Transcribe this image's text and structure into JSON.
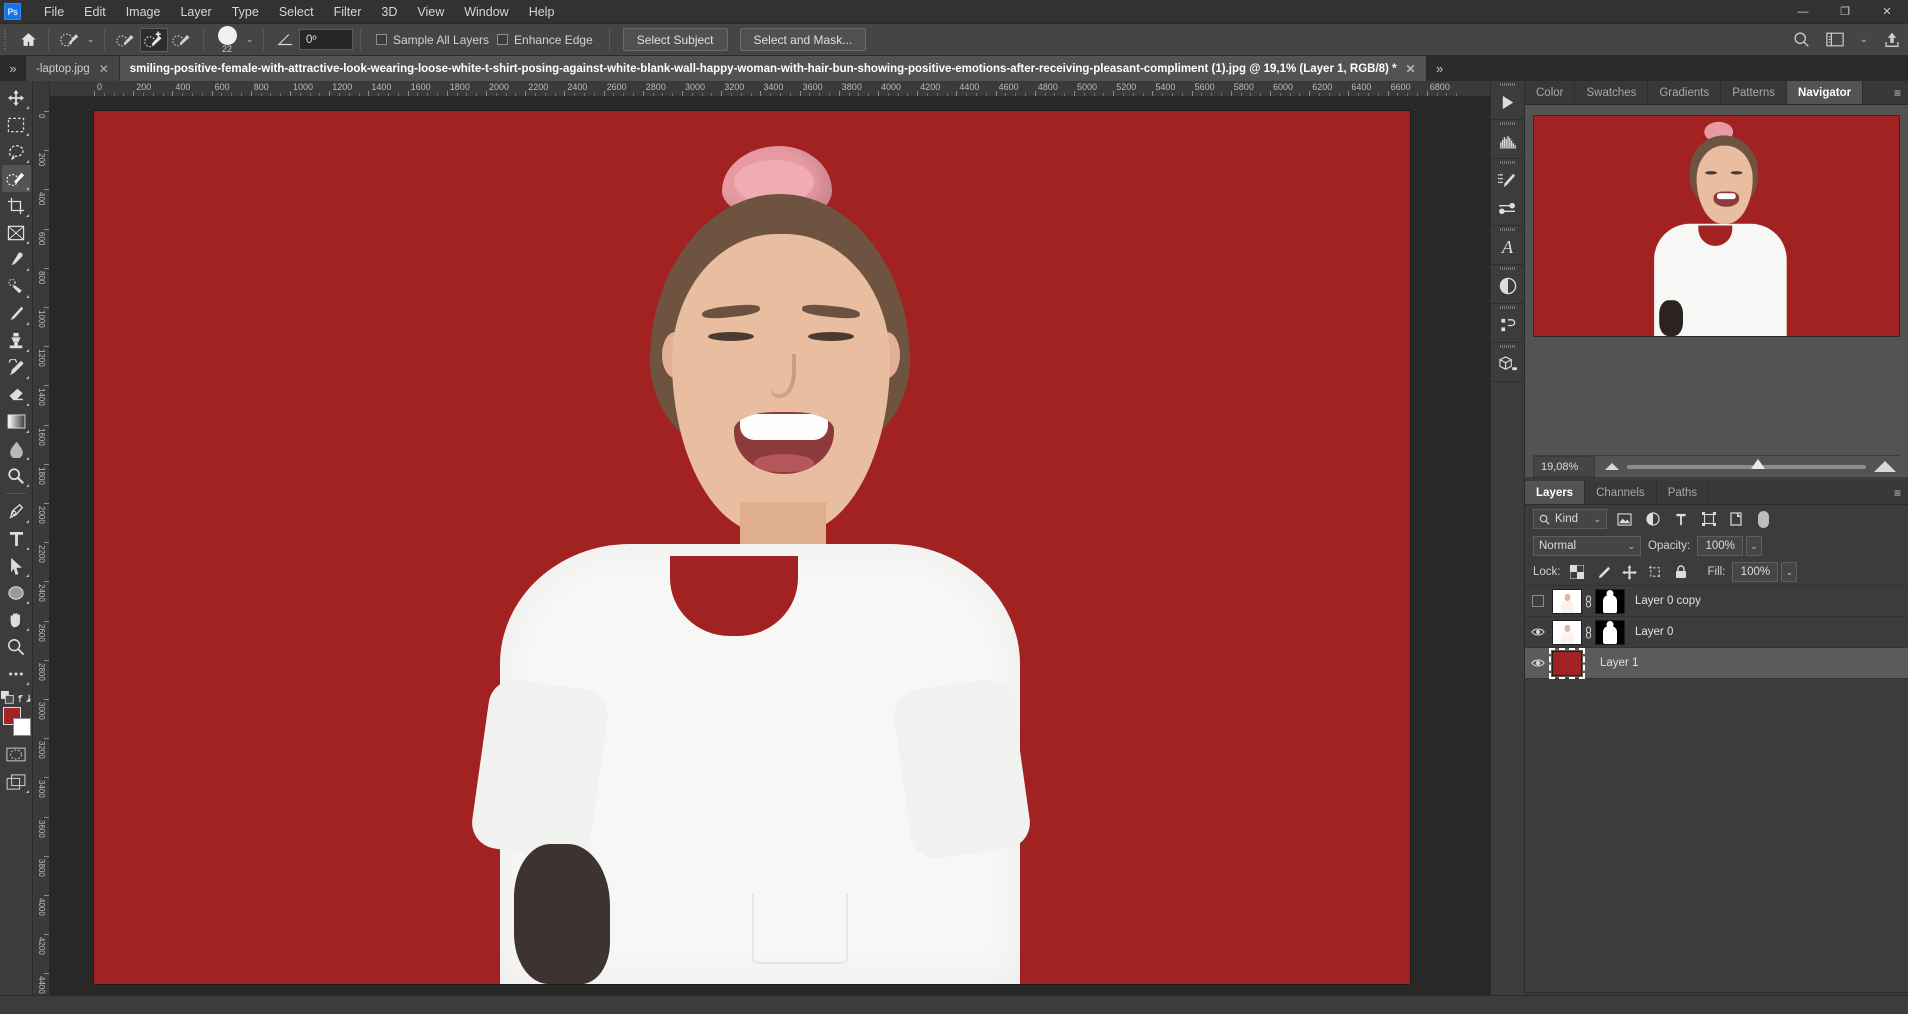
{
  "app": {
    "logo": "Ps"
  },
  "menubar": {
    "items": [
      "File",
      "Edit",
      "Image",
      "Layer",
      "Type",
      "Select",
      "Filter",
      "3D",
      "View",
      "Window",
      "Help"
    ]
  },
  "window_controls": {
    "minimize": "—",
    "maximize": "❐",
    "close": "✕"
  },
  "options_bar": {
    "home_icon": "home-icon",
    "tool_preset_icon": "quick-selection-tool-icon",
    "mode_add_icon": "selection-add-icon",
    "mode_new_icon": "selection-new-icon",
    "mode_subtract_icon": "selection-subtract-icon",
    "brush_size": "22",
    "angle_label": "angle-icon",
    "angle_value": "0º",
    "sample_all_layers": "Sample All Layers",
    "enhance_edge": "Enhance Edge",
    "select_subject": "Select Subject",
    "select_and_mask": "Select and Mask...",
    "search_icon": "search-icon",
    "workspace_icon": "workspace-icon",
    "share_icon": "share-icon"
  },
  "tabs": {
    "inactive": {
      "label": "-laptop.jpg",
      "close": "✕"
    },
    "active": {
      "label": "smiling-positive-female-with-attractive-look-wearing-loose-white-t-shirt-posing-against-white-blank-wall-happy-woman-with-hair-bun-showing-positive-emotions-after-receiving-pleasant-compliment (1).jpg @ 19,1% (Layer 1, RGB/8) *",
      "close": "✕"
    },
    "overflow": "»"
  },
  "toolbox": {
    "tools": [
      {
        "name": "move-tool",
        "icon": "move-icon"
      },
      {
        "name": "rectangular-marquee-tool",
        "icon": "marquee-icon"
      },
      {
        "name": "lasso-tool",
        "icon": "lasso-icon"
      },
      {
        "name": "quick-selection-tool",
        "icon": "quick-selection-icon",
        "selected": true
      },
      {
        "name": "crop-tool",
        "icon": "crop-icon"
      },
      {
        "name": "frame-tool",
        "icon": "frame-icon"
      },
      {
        "name": "eyedropper-tool",
        "icon": "eyedropper-icon"
      },
      {
        "name": "healing-brush-tool",
        "icon": "healing-brush-icon"
      },
      {
        "name": "brush-tool",
        "icon": "brush-icon"
      },
      {
        "name": "clone-stamp-tool",
        "icon": "clone-stamp-icon"
      },
      {
        "name": "history-brush-tool",
        "icon": "history-brush-icon"
      },
      {
        "name": "eraser-tool",
        "icon": "eraser-icon"
      },
      {
        "name": "gradient-tool",
        "icon": "gradient-icon"
      },
      {
        "name": "blur-tool",
        "icon": "blur-icon"
      },
      {
        "name": "dodge-tool",
        "icon": "dodge-icon"
      },
      {
        "name": "pen-tool",
        "icon": "pen-icon"
      },
      {
        "name": "type-tool",
        "icon": "type-icon"
      },
      {
        "name": "path-selection-tool",
        "icon": "path-selection-icon"
      },
      {
        "name": "ellipse-tool",
        "icon": "ellipse-icon"
      },
      {
        "name": "hand-tool",
        "icon": "hand-icon"
      },
      {
        "name": "zoom-tool",
        "icon": "zoom-icon"
      },
      {
        "name": "edit-toolbar",
        "icon": "more-icon"
      }
    ],
    "foreground_color": "#A22222",
    "background_color": "#FFFFFF",
    "quick_mask": "quick-mask-icon",
    "screen_mode": "screen-mode-icon"
  },
  "ruler": {
    "unit": "px",
    "labels": [
      "0",
      "200",
      "400",
      "600",
      "800",
      "1000",
      "1200",
      "1400",
      "1600",
      "1800",
      "2000",
      "2200",
      "2400",
      "2600",
      "2800",
      "3000",
      "3200",
      "3400",
      "3600",
      "3800",
      "4000",
      "4200",
      "4400",
      "4600",
      "4800",
      "5000",
      "5200",
      "5400",
      "5600",
      "5800",
      "6000",
      "6200",
      "6400",
      "6600",
      "6800"
    ],
    "v_labels": [
      "0",
      "200",
      "400",
      "600",
      "800",
      "1000",
      "1200",
      "1400",
      "1600",
      "1800",
      "2000",
      "2200",
      "2400",
      "2600",
      "2800",
      "3000",
      "3200",
      "3400",
      "3600",
      "3800",
      "4000",
      "4200",
      "4400"
    ]
  },
  "canvas": {
    "background_color": "#A22222",
    "document_color": "#282828"
  },
  "right_rail": {
    "icons": [
      "libraries-icon",
      "histogram-icon",
      "brush-settings-icon",
      "brush-presets-icon",
      "character-icon",
      "adjustments-icon",
      "actions-icon",
      "3d-icon"
    ]
  },
  "panel_group_top": {
    "tabs": [
      {
        "label": "Color",
        "active": false
      },
      {
        "label": "Swatches",
        "active": false
      },
      {
        "label": "Gradients",
        "active": false
      },
      {
        "label": "Patterns",
        "active": false
      },
      {
        "label": "Navigator",
        "active": true
      }
    ],
    "menu_icon": "panel-menu-icon"
  },
  "navigator": {
    "zoom_value": "19,08%",
    "zoom_out_icon": "zoom-out-icon",
    "zoom_in_icon": "zoom-in-icon",
    "slider_position_percent": 52
  },
  "panel_group_layers": {
    "tabs": [
      {
        "label": "Layers",
        "active": true
      },
      {
        "label": "Channels",
        "active": false
      },
      {
        "label": "Paths",
        "active": false
      }
    ],
    "menu_icon": "panel-menu-icon"
  },
  "layers_panel": {
    "filter_label": "Kind",
    "filter_icons": [
      "filter-pixel-icon",
      "filter-adjustment-icon",
      "filter-type-icon",
      "filter-shape-icon",
      "filter-smart-object-icon"
    ],
    "filter_toggle": "filter-enable-toggle",
    "blend_mode": "Normal",
    "opacity_label": "Opacity:",
    "opacity_value": "100%",
    "lock_label": "Lock:",
    "lock_icons": [
      "lock-transparent-pixels-icon",
      "lock-image-pixels-icon",
      "lock-position-icon",
      "lock-artboard-nesting-icon",
      "lock-all-icon"
    ],
    "fill_label": "Fill:",
    "fill_value": "100%",
    "layers": [
      {
        "name": "Layer 0 copy",
        "visible": false,
        "type": "image-with-mask",
        "selected": false
      },
      {
        "name": "Layer 0",
        "visible": true,
        "type": "image-with-mask",
        "selected": false
      },
      {
        "name": "Layer 1",
        "visible": true,
        "type": "solid-fill",
        "color": "#A22222",
        "selected": true
      }
    ],
    "footer_icons": [
      "link-layers-icon",
      "layer-style-fx-icon",
      "add-layer-mask-icon",
      "new-adjustment-layer-icon",
      "new-group-icon",
      "new-layer-icon",
      "delete-layer-icon"
    ]
  }
}
